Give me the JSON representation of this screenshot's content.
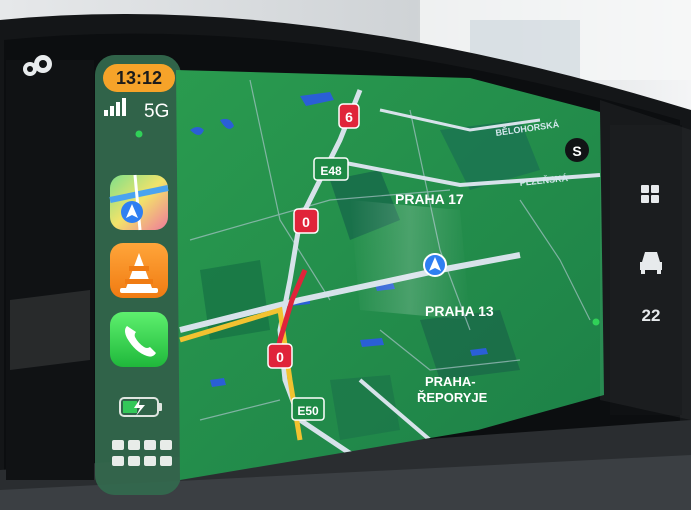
{
  "status": {
    "time": "13:12",
    "network": "5G"
  },
  "map": {
    "labels": {
      "praha17": "PRAHA 17",
      "praha13": "PRAHA 13",
      "reporyje_line1": "PRAHA-",
      "reporyje_line2": "ŘEPORYJE",
      "belohorska": "BĚLOHORSKÁ",
      "plzenska": "PLZEŇSKÁ"
    },
    "route_shields": [
      "6",
      "E48",
      "0",
      "0",
      "E50"
    ],
    "compass": "S"
  },
  "right_rail": {
    "speed_value": "22"
  },
  "dock_apps": [
    "Maps",
    "VLC",
    "Phone",
    "Battery"
  ],
  "colors": {
    "map_green": "#1f9a4c",
    "time_badge": "#f6a329",
    "route_red": "#e0243a",
    "phone_green": "#2fce4e"
  }
}
